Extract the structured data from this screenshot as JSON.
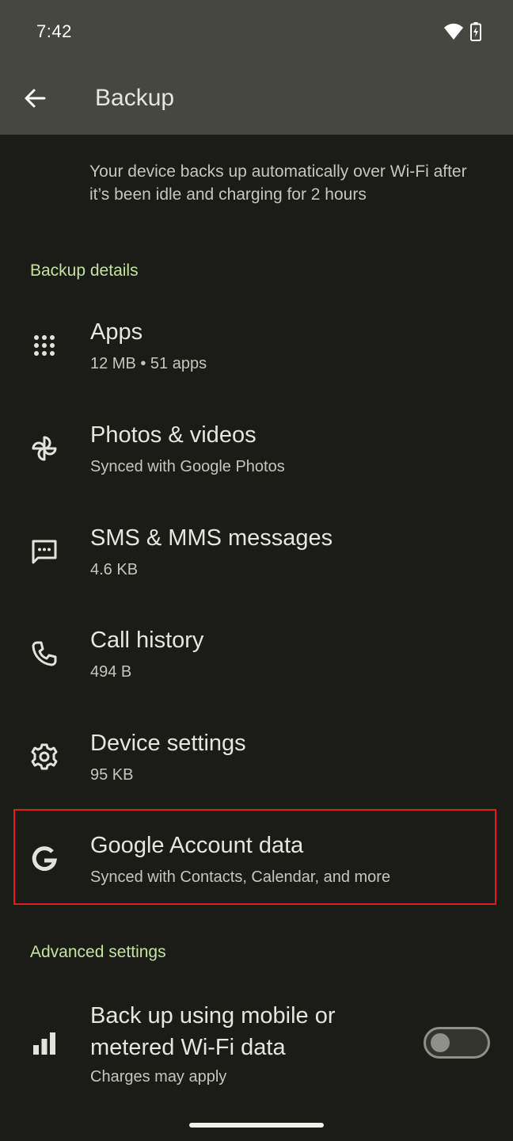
{
  "status_bar": {
    "time": "7:42",
    "icons": [
      "wifi-icon",
      "battery-charging-icon"
    ]
  },
  "app_bar": {
    "title": "Backup",
    "back_icon": "arrow-back-icon"
  },
  "intro_text": "Your device backs up automatically over Wi-Fi after it’s been idle and charging for 2 hours",
  "sections": {
    "backup_details": "Backup details",
    "advanced_settings": "Advanced settings"
  },
  "items": [
    {
      "icon": "apps-grid-icon",
      "title": "Apps",
      "subtitle": "12 MB • 51 apps"
    },
    {
      "icon": "photos-pinwheel-icon",
      "title": "Photos & videos",
      "subtitle": "Synced with Google Photos"
    },
    {
      "icon": "message-icon",
      "title": "SMS & MMS messages",
      "subtitle": "4.6 KB"
    },
    {
      "icon": "phone-icon",
      "title": "Call history",
      "subtitle": "494 B"
    },
    {
      "icon": "gear-icon",
      "title": "Device settings",
      "subtitle": "95 KB"
    },
    {
      "icon": "google-g-icon",
      "title": "Google Account data",
      "subtitle": "Synced with Contacts, Calendar, and more"
    }
  ],
  "metered": {
    "icon": "signal-bars-icon",
    "title": "Back up using mobile or metered Wi-Fi data",
    "subtitle": "Charges may apply",
    "toggle_on": false
  },
  "colors": {
    "background": "#1b1c18",
    "app_bar": "#464741",
    "section_header": "#c5e39d",
    "highlight": "#e21b1b"
  }
}
